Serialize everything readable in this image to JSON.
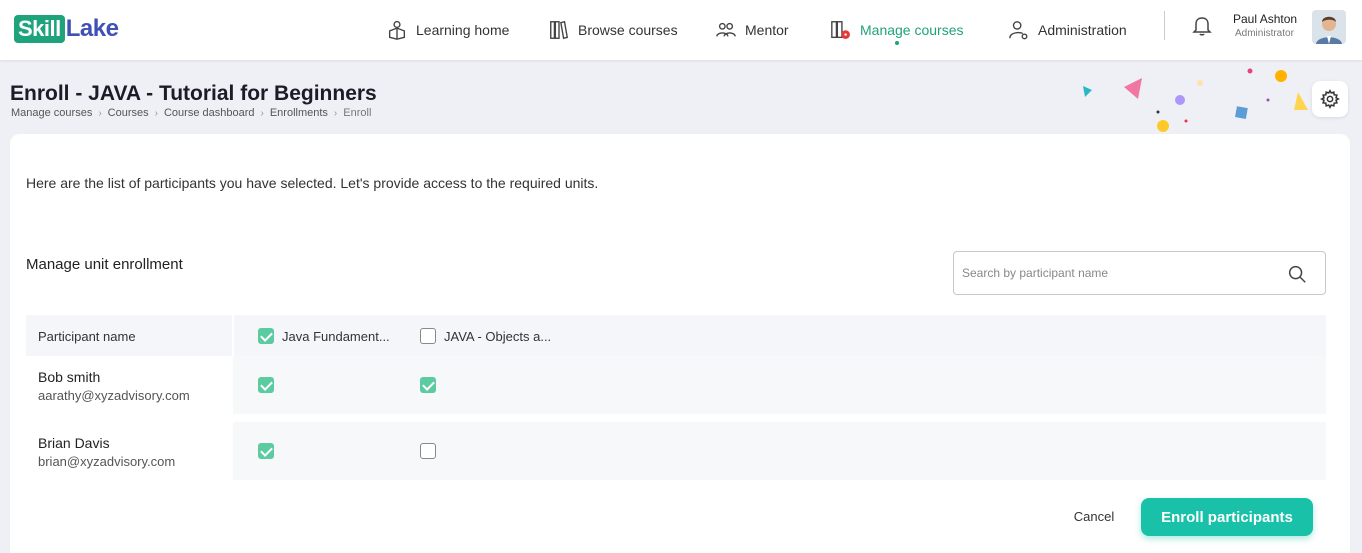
{
  "brand": {
    "part1": "Skill",
    "part2": "Lake"
  },
  "nav": [
    {
      "label": "Learning home",
      "icon": "learning-home-icon"
    },
    {
      "label": "Browse courses",
      "icon": "books-icon"
    },
    {
      "label": "Mentor",
      "icon": "mentor-icon"
    },
    {
      "label": "Manage courses",
      "icon": "manage-courses-icon",
      "active": true
    },
    {
      "label": "Administration",
      "icon": "user-gear-icon"
    }
  ],
  "user": {
    "name": "Paul Ashton",
    "role": "Administrator"
  },
  "page": {
    "title": "Enroll - JAVA - Tutorial for Beginners",
    "breadcrumb": [
      "Manage courses",
      "Courses",
      "Course dashboard",
      "Enrollments",
      "Enroll"
    ]
  },
  "card": {
    "intro": "Here are the list of participants you have selected. Let's provide access to the required units.",
    "section_title": "Manage unit enrollment",
    "search": {
      "placeholder": "Search by participant name",
      "value": ""
    },
    "table": {
      "name_header": "Participant name",
      "units": [
        {
          "label": "Java Fundament...",
          "checked": true
        },
        {
          "label": "JAVA - Objects a...",
          "checked": false
        }
      ],
      "rows": [
        {
          "name": "Bob smith",
          "email": "aarathy@xyzadvisory.com",
          "units": [
            true,
            true
          ]
        },
        {
          "name": "Brian Davis",
          "email": "brian@xyzadvisory.com",
          "units": [
            true,
            false
          ]
        }
      ]
    },
    "actions": {
      "cancel": "Cancel",
      "enroll": "Enroll participants"
    }
  },
  "colors": {
    "accent": "#1fa37c",
    "button": "#19c1a8",
    "checkbox": "#5ccba0",
    "brand_blue": "#3f51b5"
  }
}
